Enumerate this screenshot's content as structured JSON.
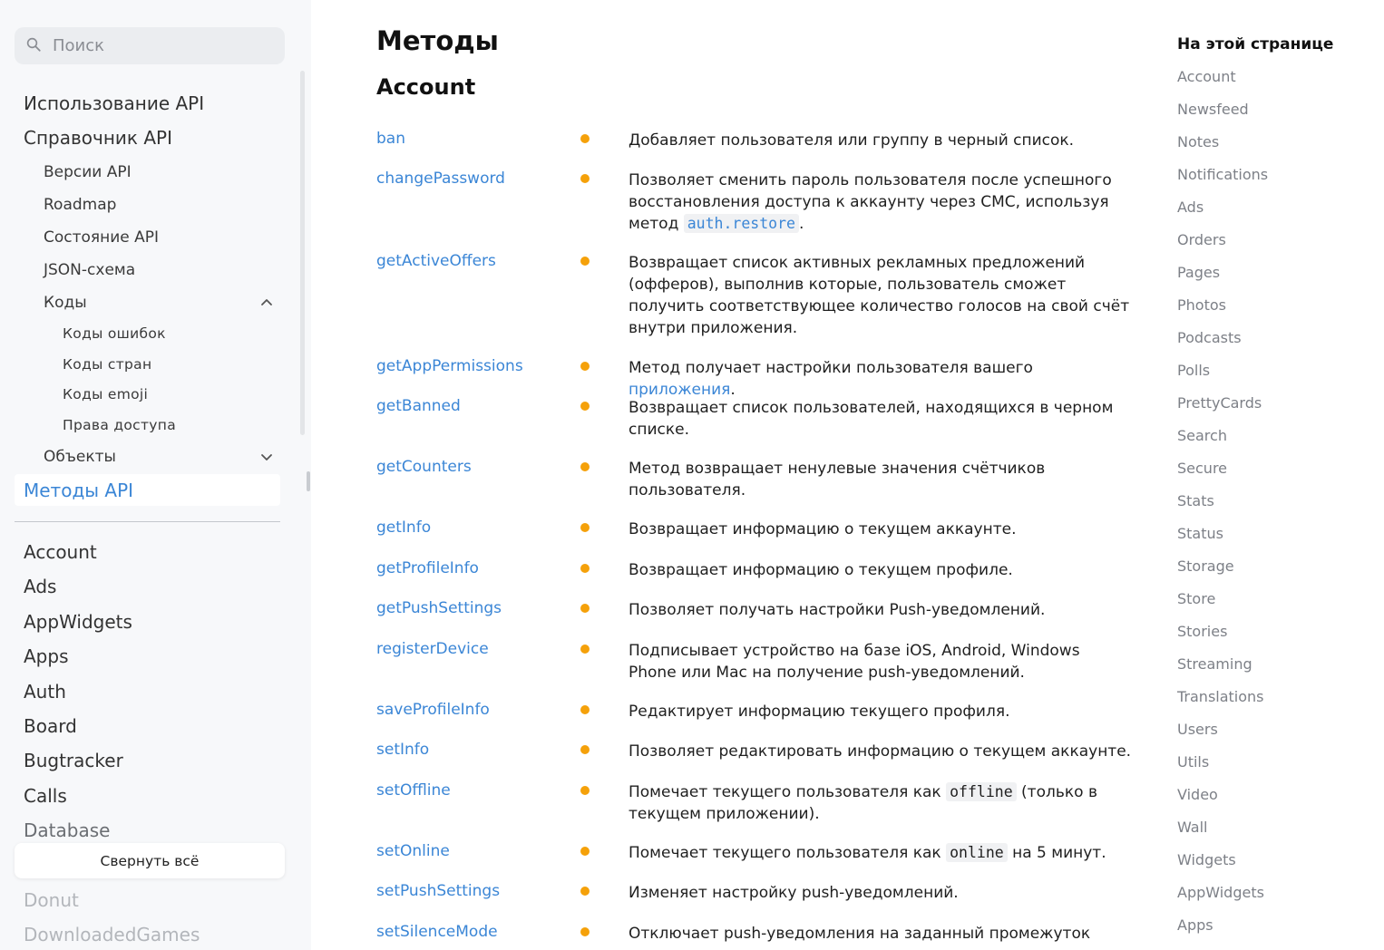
{
  "search": {
    "placeholder": "Поиск"
  },
  "sidebar": {
    "top_items": [
      {
        "label": "Использование API"
      },
      {
        "label": "Справочник API"
      }
    ],
    "reference_items": [
      {
        "label": "Версии API"
      },
      {
        "label": "Roadmap"
      },
      {
        "label": "Состояние API"
      },
      {
        "label": "JSON-схема"
      },
      {
        "label": "Коды"
      }
    ],
    "codes_items": [
      {
        "label": "Коды ошибок"
      },
      {
        "label": "Коды стран"
      },
      {
        "label": "Коды emoji"
      },
      {
        "label": "Права доступа"
      }
    ],
    "objects_label": "Объекты",
    "active_label": "Методы API",
    "sections": [
      {
        "label": "Account"
      },
      {
        "label": "Ads"
      },
      {
        "label": "AppWidgets"
      },
      {
        "label": "Apps"
      },
      {
        "label": "Auth"
      },
      {
        "label": "Board"
      },
      {
        "label": "Bugtracker"
      },
      {
        "label": "Calls"
      },
      {
        "label": "Database"
      },
      {
        "label": "Donut"
      },
      {
        "label": "DownloadedGames"
      }
    ],
    "collapse_all": "Свернуть всё"
  },
  "main": {
    "title": "Методы",
    "section": "Account",
    "methods": [
      {
        "name": "ban",
        "desc": "Добавляет пользователя или группу в черный список."
      },
      {
        "name": "changePassword",
        "desc_before": "Позволяет сменить пароль пользователя после успешного восстановления доступа к аккаунту через СМС, используя метод ",
        "code": "auth.restore",
        "desc_after": "."
      },
      {
        "name": "getActiveOffers",
        "desc": "Возвращает список активных рекламных предложений (офферов), выполнив которые, пользователь сможет получить соответствующее количество голосов на свой счёт внутри приложения."
      },
      {
        "name": "getAppPermissions",
        "desc_before": "Метод получает настройки пользователя вашего ",
        "link": "приложения",
        "desc_after": "."
      },
      {
        "name": "getBanned",
        "desc": "Возвращает список пользователей, находящихся в черном списке."
      },
      {
        "name": "getCounters",
        "desc": "Метод возвращает ненулевые значения счётчиков пользователя."
      },
      {
        "name": "getInfo",
        "desc": "Возвращает информацию о текущем аккаунте."
      },
      {
        "name": "getProfileInfo",
        "desc": "Возвращает информацию о текущем профиле."
      },
      {
        "name": "getPushSettings",
        "desc": "Позволяет получать настройки Push-уведомлений."
      },
      {
        "name": "registerDevice",
        "desc": "Подписывает устройство на базе iOS, Android, Windows Phone или Mac на получение push-уведомлений."
      },
      {
        "name": "saveProfileInfo",
        "desc": "Редактирует информацию текущего профиля."
      },
      {
        "name": "setInfo",
        "desc": "Позволяет редактировать информацию о текущем аккаунте."
      },
      {
        "name": "setOffline",
        "desc_before": "Помечает текущего пользователя как ",
        "code": "offline",
        "desc_after": " (только в текущем приложении)."
      },
      {
        "name": "setOnline",
        "desc_before": "Помечает текущего пользователя как ",
        "code": "online",
        "desc_after": " на 5 минут."
      },
      {
        "name": "setPushSettings",
        "desc": "Изменяет настройку push-уведомлений."
      },
      {
        "name": "setSilenceMode",
        "desc": "Отключает push-уведомления на заданный промежуток"
      }
    ]
  },
  "toc": {
    "title": "На этой странице",
    "items": [
      "Account",
      "Newsfeed",
      "Notes",
      "Notifications",
      "Ads",
      "Orders",
      "Pages",
      "Photos",
      "Podcasts",
      "Polls",
      "PrettyCards",
      "Search",
      "Secure",
      "Stats",
      "Status",
      "Storage",
      "Store",
      "Stories",
      "Streaming",
      "Translations",
      "Users",
      "Utils",
      "Video",
      "Wall",
      "Widgets",
      "AppWidgets",
      "Apps"
    ]
  },
  "colors": {
    "link": "#3b86d6",
    "dot": "#f5a10a",
    "sidebar_bg": "#f7f8fa"
  }
}
